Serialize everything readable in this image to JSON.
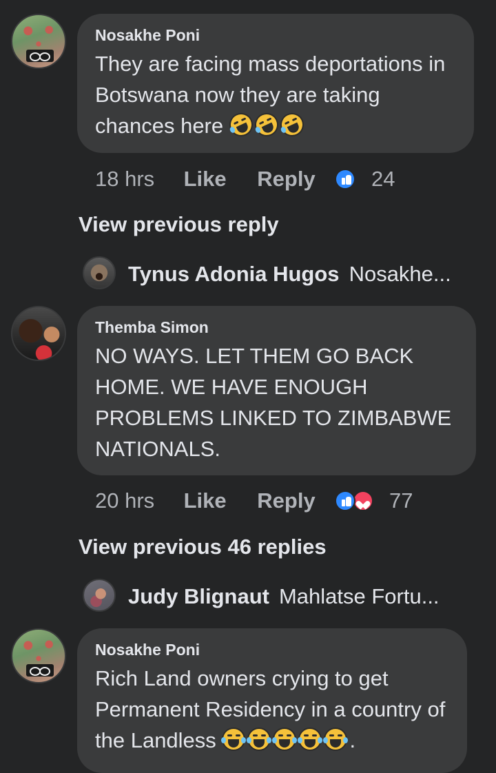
{
  "comments": [
    {
      "author": "Nosakhe Poni",
      "text": "They are facing mass deportations in Botswana now they are taking chances here",
      "emojis": [
        "rolling-on-floor-laughing-emoji",
        "rolling-on-floor-laughing-emoji",
        "rolling-on-floor-laughing-emoji"
      ],
      "time": "18 hrs",
      "like_label": "Like",
      "reply_label": "Reply",
      "reactions": [
        "like-icon"
      ],
      "reaction_count": "24"
    },
    {
      "author": "Themba Simon",
      "text": "NO WAYS. LET THEM GO BACK HOME. WE HAVE ENOUGH PROBLEMS LINKED TO ZIMBABWE NATIONALS.",
      "time": "20 hrs",
      "like_label": "Like",
      "reply_label": "Reply",
      "reactions": [
        "like-icon",
        "love-icon"
      ],
      "reaction_count": "77"
    },
    {
      "author": "Nosakhe Poni",
      "text": "Rich Land owners crying to get Permanent Residency in a country of the Landless",
      "emojis": [
        "face-with-tears-of-joy-emoji",
        "face-with-tears-of-joy-emoji",
        "face-with-tears-of-joy-emoji",
        "face-with-tears-of-joy-emoji",
        "face-with-tears-of-joy-emoji"
      ],
      "suffix": "."
    }
  ],
  "view_previous": [
    {
      "label": "View previous reply"
    },
    {
      "label": "View previous 46 replies"
    }
  ],
  "collapsed_replies": [
    {
      "author": "Tynus Adonia Hugos",
      "preview": "Nosakhe..."
    },
    {
      "author": "Judy Blignaut",
      "preview": "Mahlatse Fortu..."
    }
  ],
  "colors": {
    "background": "#242526",
    "bubble": "#3a3b3c",
    "primary_text": "#e4e6eb",
    "secondary_text": "#b0b3b8",
    "like_blue": "#2e89ff",
    "love_red": "#f3425f"
  }
}
